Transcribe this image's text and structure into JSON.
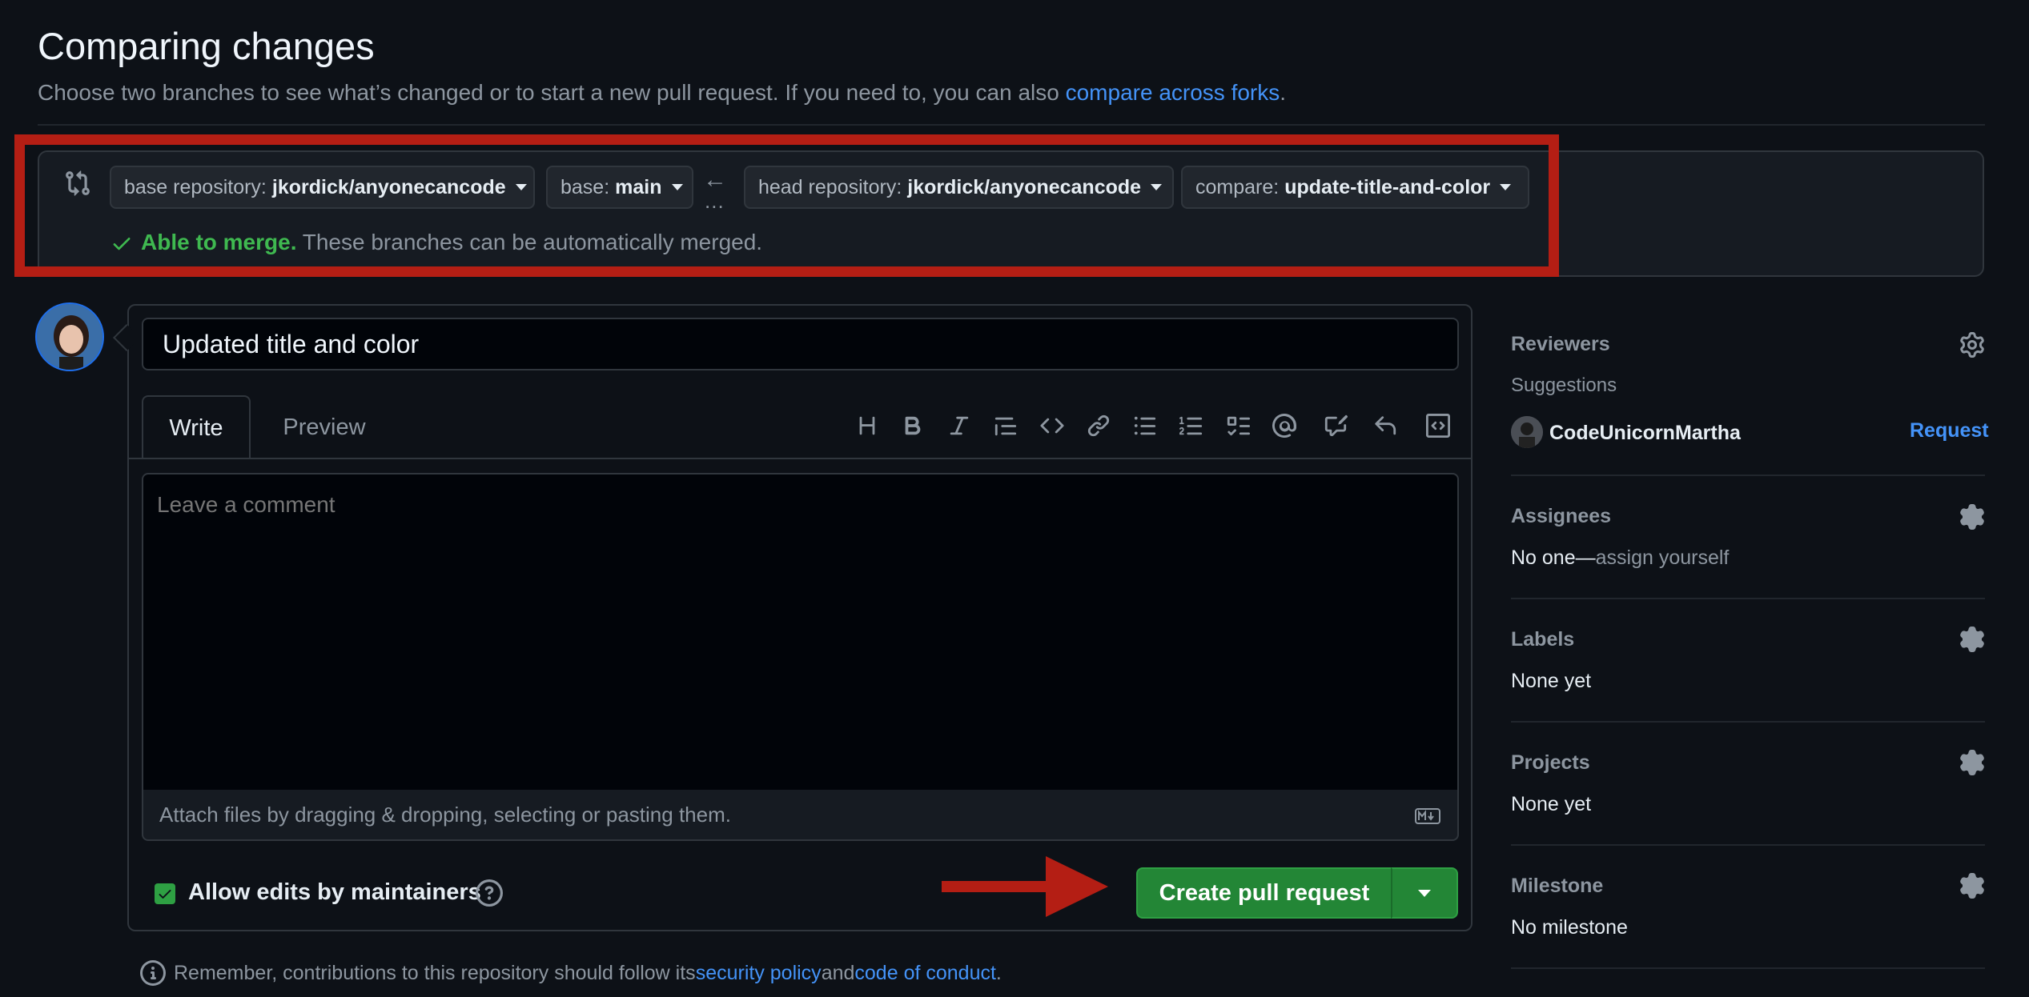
{
  "page": {
    "title": "Comparing changes",
    "subtitle_text": "Choose two branches to see what’s changed or to start a new pull request. If you need to, you can also ",
    "subtitle_link": "compare across forks",
    "subtitle_end": "."
  },
  "compare": {
    "base_repo_label": "base repository:",
    "base_repo_value": "jkordick/anyonecancode",
    "base_label": "base:",
    "base_value": "main",
    "arrow": "←",
    "dots": "...",
    "head_repo_label": "head repository:",
    "head_repo_value": "jkordick/anyonecancode",
    "compare_label": "compare:",
    "compare_value": "update-title-and-color",
    "merge_status": "Able to merge.",
    "merge_detail": " These branches can be automatically merged.",
    "status_color": "#3fb950"
  },
  "form": {
    "title_value": "Updated title and color",
    "tab_write": "Write",
    "tab_preview": "Preview",
    "toolbar_icons": [
      "heading-icon",
      "bold-icon",
      "italic-icon",
      "quote-icon",
      "code-icon",
      "link-icon",
      "unordered-list-icon",
      "ordered-list-icon",
      "task-list-icon",
      "mention-icon",
      "cross-reference-icon",
      "reply-icon",
      "slash-command-icon"
    ],
    "comment_placeholder": "Leave a comment",
    "attach_text": "Attach files by dragging & dropping, selecting or pasting them.",
    "allow_edits_label": "Allow edits by maintainers",
    "allow_edits_checked": true,
    "create_button": "Create pull request",
    "accent": "#238636"
  },
  "footer": {
    "info_text": "Remember, contributions to this repository should follow its ",
    "security_link": "security policy",
    "and_text": " and ",
    "conduct_link": "code of conduct",
    "end": "."
  },
  "sidebar": {
    "reviewers_heading": "Reviewers",
    "suggestions_label": "Suggestions",
    "suggested_user": "CodeUnicornMartha",
    "request_link": "Request",
    "assignees_heading": "Assignees",
    "assignees_value": "No one—",
    "assign_yourself": "assign yourself",
    "labels_heading": "Labels",
    "labels_value": "None yet",
    "projects_heading": "Projects",
    "projects_value": "None yet",
    "milestone_heading": "Milestone",
    "milestone_value": "No milestone"
  }
}
